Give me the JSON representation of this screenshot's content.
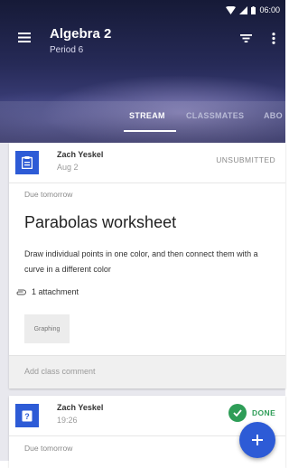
{
  "status_bar": {
    "time": "06:00"
  },
  "header": {
    "title": "Algebra 2",
    "subtitle": "Period 6",
    "tabs": [
      {
        "label": "STREAM",
        "active": true
      },
      {
        "label": "CLASSMATES",
        "active": false
      },
      {
        "label": "ABO",
        "active": false
      }
    ]
  },
  "posts": [
    {
      "icon": "assignment-icon",
      "author": "Zach Yeskel",
      "date": "Aug 2",
      "status": "UNSUBMITTED",
      "due": "Due tomorrow",
      "title": "Parabolas worksheet",
      "description": "Draw individual points in one color, and then connect them with a curve in a different color",
      "attachments_label": "1 attachment",
      "attachment_chip": "Graphing",
      "comment_placeholder": "Add class comment"
    },
    {
      "icon": "question-icon",
      "author": "Zach Yeskel",
      "date": "19:26",
      "status": "DONE",
      "due": "Due tomorrow"
    }
  ],
  "fab": {
    "icon": "plus-icon"
  },
  "colors": {
    "accent": "#2d5bd6",
    "done": "#2e9d57",
    "header_dark": "#161a37"
  }
}
